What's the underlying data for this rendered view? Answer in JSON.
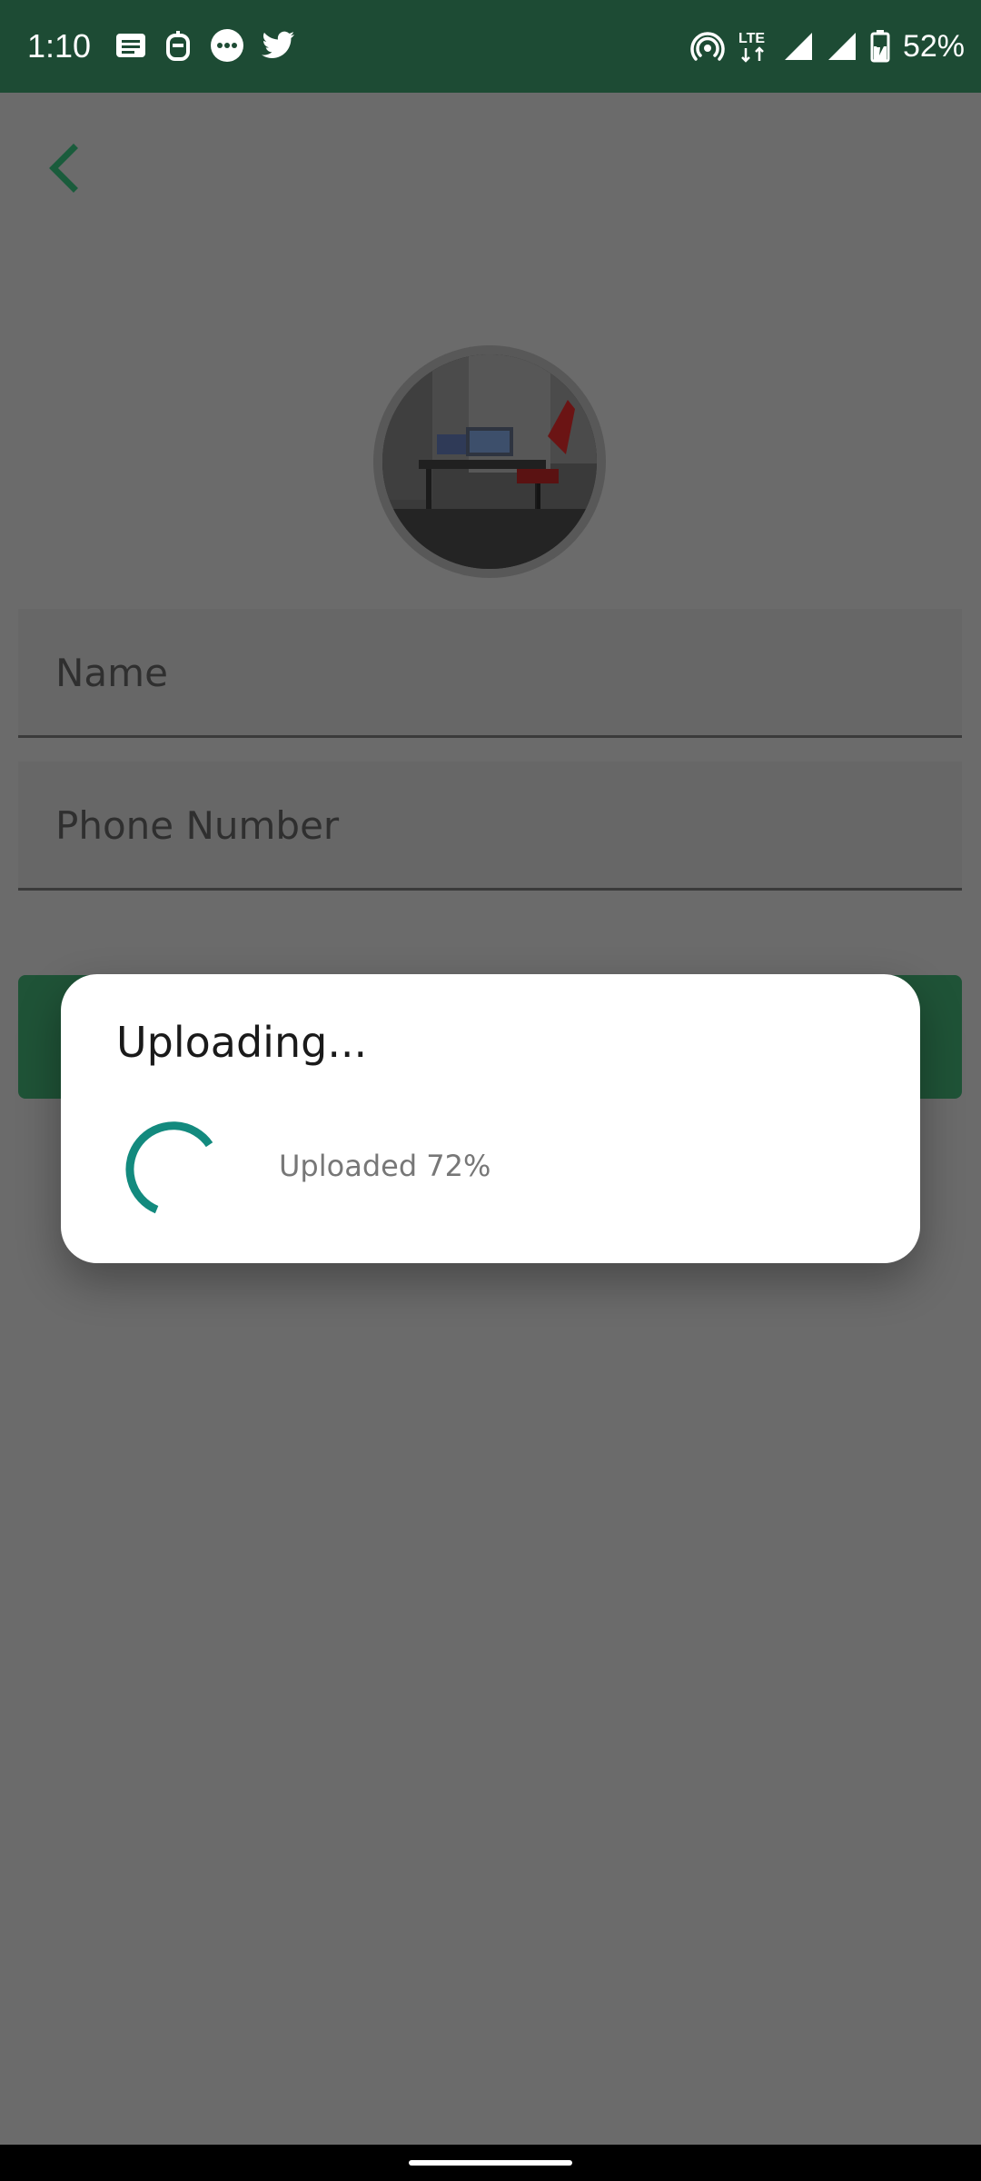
{
  "status_bar": {
    "time": "1:10",
    "battery_percent": "52%",
    "network": "LTE",
    "left_icons": [
      "message-icon",
      "robot-icon",
      "messenger-icon",
      "twitter-icon"
    ],
    "right_icons": [
      "hotspot-icon",
      "lte-icon",
      "signal-icon",
      "signal-icon",
      "battery-charging-icon"
    ]
  },
  "page": {
    "back_icon": "chevron-left-icon",
    "avatar_alt": "profile photo",
    "fields": {
      "name_placeholder": "Name",
      "phone_placeholder": "Phone Number"
    }
  },
  "dialog": {
    "title": "Uploading...",
    "progress_text": "Uploaded 72%",
    "progress_value": 72
  },
  "colors": {
    "status_bar_bg": "#1d4b34",
    "accent_green": "#1a7a4d",
    "spinner": "#138a7e",
    "scrim": "#6b6b6b",
    "dialog_bg": "#ffffff"
  }
}
